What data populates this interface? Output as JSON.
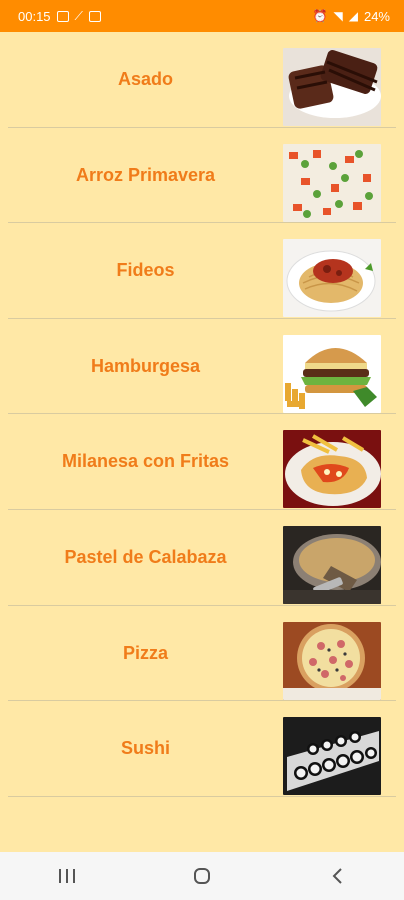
{
  "status_bar": {
    "time": "00:15",
    "battery": "24%",
    "left_icons": [
      "image-icon",
      "signal-off-icon",
      "app-icon"
    ],
    "right_icons": [
      "alarm-icon",
      "wifi-icon",
      "signal-icon"
    ]
  },
  "colors": {
    "status_bar": "#FF8C00",
    "background": "#FFE8A6",
    "label": "#F07C1A"
  },
  "dishes": [
    {
      "label": "Asado",
      "image": "grilled-meat-photo"
    },
    {
      "label": "Arroz Primavera",
      "image": "rice-salad-photo"
    },
    {
      "label": "Fideos",
      "image": "spaghetti-photo"
    },
    {
      "label": "Hamburgesa",
      "image": "hamburger-photo"
    },
    {
      "label": "Milanesa con Fritas",
      "image": "milanesa-photo"
    },
    {
      "label": "Pastel de Calabaza",
      "image": "pumpkin-pie-photo"
    },
    {
      "label": "Pizza",
      "image": "pizza-photo"
    },
    {
      "label": "Sushi",
      "image": "sushi-photo"
    }
  ],
  "nav_bar": {
    "buttons": [
      "recent-apps-icon",
      "home-icon",
      "back-icon"
    ]
  }
}
